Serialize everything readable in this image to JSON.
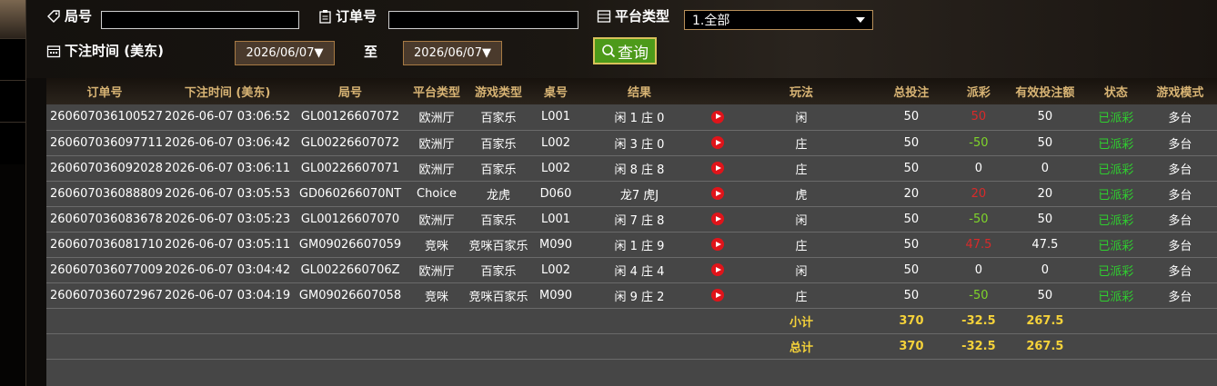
{
  "filters": {
    "round_label": "局号",
    "round_value": "",
    "order_label": "订单号",
    "order_value": "",
    "platform_label": "平台类型",
    "platform_selected": "1.全部",
    "bettime_label": "下注时间 (美东)",
    "date_from": "2026/06/07▼",
    "date_to_label": "至",
    "date_to": "2026/06/07▼",
    "query_button": "查询"
  },
  "table": {
    "headers": [
      "订单号",
      "下注时间 (美东)",
      "局号",
      "平台类型",
      "游戏类型",
      "桌号",
      "结果",
      "",
      "玩法",
      "总投注",
      "派彩",
      "有效投注额",
      "状态",
      "游戏模式"
    ],
    "rows": [
      {
        "order": "260607036100527",
        "time": "2026-06-07 03:06:52",
        "round": "GL00126607072",
        "platform": "欧洲厅",
        "game": "百家乐",
        "table": "L001",
        "result": "闲 1 庄 0",
        "bet": "闲",
        "total": "50",
        "payout": "50",
        "payout_color": "red",
        "valid": "50",
        "status": "已派彩",
        "mode": "多台"
      },
      {
        "order": "260607036097711",
        "time": "2026-06-07 03:06:42",
        "round": "GL00226607072",
        "platform": "欧洲厅",
        "game": "百家乐",
        "table": "L002",
        "result": "闲 3 庄 0",
        "bet": "庄",
        "total": "50",
        "payout": "-50",
        "payout_color": "grn",
        "valid": "50",
        "status": "已派彩",
        "mode": "多台"
      },
      {
        "order": "260607036092028",
        "time": "2026-06-07 03:06:11",
        "round": "GL00226607071",
        "platform": "欧洲厅",
        "game": "百家乐",
        "table": "L002",
        "result": "闲 8 庄 8",
        "bet": "庄",
        "total": "50",
        "payout": "0",
        "payout_color": "wht",
        "valid": "0",
        "status": "已派彩",
        "mode": "多台"
      },
      {
        "order": "260607036088809",
        "time": "2026-06-07 03:05:53",
        "round": "GD060266070NT",
        "platform": "Choice",
        "game": "龙虎",
        "table": "D060",
        "result": "龙7 虎J",
        "bet": "虎",
        "total": "20",
        "payout": "20",
        "payout_color": "red",
        "valid": "20",
        "status": "已派彩",
        "mode": "多台"
      },
      {
        "order": "260607036083678",
        "time": "2026-06-07 03:05:23",
        "round": "GL00126607070",
        "platform": "欧洲厅",
        "game": "百家乐",
        "table": "L001",
        "result": "闲 7 庄 8",
        "bet": "闲",
        "total": "50",
        "payout": "-50",
        "payout_color": "grn",
        "valid": "50",
        "status": "已派彩",
        "mode": "多台"
      },
      {
        "order": "260607036081710",
        "time": "2026-06-07 03:05:11",
        "round": "GM09026607059",
        "platform": "竞咪",
        "game": "竞咪百家乐",
        "table": "M090",
        "result": "闲 1 庄 9",
        "bet": "庄",
        "total": "50",
        "payout": "47.5",
        "payout_color": "red",
        "valid": "47.5",
        "status": "已派彩",
        "mode": "多台"
      },
      {
        "order": "260607036077009",
        "time": "2026-06-07 03:04:42",
        "round": "GL0022660706Z",
        "platform": "欧洲厅",
        "game": "百家乐",
        "table": "L002",
        "result": "闲 4 庄 4",
        "bet": "闲",
        "total": "50",
        "payout": "0",
        "payout_color": "wht",
        "valid": "0",
        "status": "已派彩",
        "mode": "多台"
      },
      {
        "order": "260607036072967",
        "time": "2026-06-07 03:04:19",
        "round": "GM09026607058",
        "platform": "竞咪",
        "game": "竞咪百家乐",
        "table": "M090",
        "result": "闲 9 庄 2",
        "bet": "庄",
        "total": "50",
        "payout": "-50",
        "payout_color": "grn",
        "valid": "50",
        "status": "已派彩",
        "mode": "多台"
      }
    ],
    "subtotal": {
      "label": "小计",
      "total": "370",
      "payout": "-32.5",
      "valid": "267.5"
    },
    "grandtotal": {
      "label": "总计",
      "total": "370",
      "payout": "-32.5",
      "valid": "267.5"
    }
  },
  "colors": {
    "header_text": "#d8b474",
    "payout_win": "#d82a2a",
    "payout_loss": "#7fd52a",
    "status": "#2fcf2f",
    "summary": "#f5d23a",
    "query_button": "#4d9a1a"
  }
}
